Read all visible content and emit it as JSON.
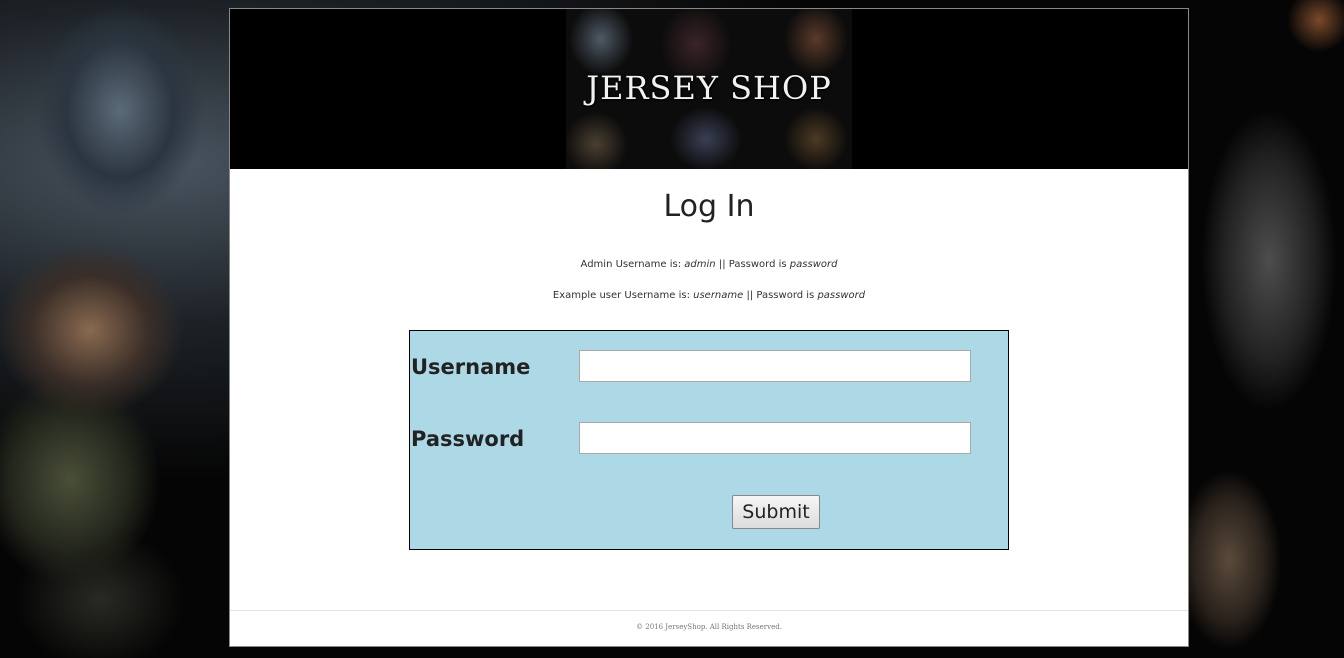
{
  "header": {
    "brand": "JERSEY SHOP"
  },
  "main": {
    "title": "Log In",
    "hints": {
      "admin": {
        "prefix": "Admin Username is: ",
        "username": "admin",
        "separator": " || Password is ",
        "password": "password"
      },
      "example": {
        "prefix": "Example user Username is: ",
        "username": "username",
        "separator": " || Password is ",
        "password": "password"
      }
    },
    "form": {
      "username_label": "Username",
      "username_value": "",
      "password_label": "Password",
      "password_value": "",
      "submit_label": "Submit"
    }
  },
  "footer": {
    "copyright": "© 2016 JerseyShop. All Rights Reserved."
  }
}
